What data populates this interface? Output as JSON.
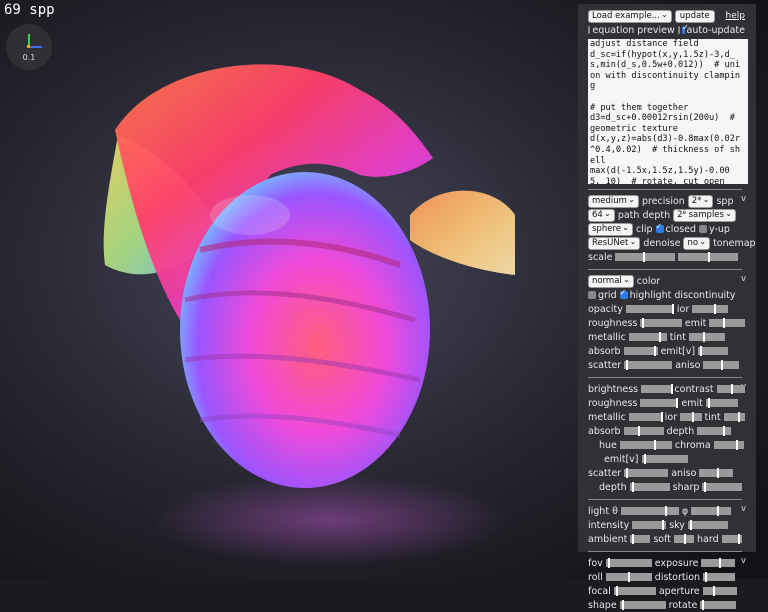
{
  "overlay": {
    "spp_text": "69 spp",
    "axes_scale": "0.1"
  },
  "panel": {
    "top": {
      "load_select": "Load example...",
      "update_label": "update",
      "help_label": "help",
      "equation_preview": "equation preview",
      "auto_update": "auto-update"
    },
    "code_lines": [
      "adjust distance field",
      "d_sc=if(hypot(x,y,1.5z)-3,d_",
      "s,min(d_s,0.5w+0.012))  # uni",
      "on with discontinuity clampin",
      "g",
      "",
      "# put them together",
      "d3=d_sc+0.00012rsin(200u)  #",
      "geometric texture",
      "d(x,y,z)=abs(d3)-0.8max(0.02r",
      "^0.4,0.02)  # thickness of sh",
      "ell",
      "max(d(-1.5x,1.5z,1.5y)-0.00",
      "5, 10)  # rotate, cut open"
    ],
    "render": {
      "precision_value": "medium",
      "precision_label": "precision",
      "spp_value": "2*",
      "spp_label": "spp",
      "depth_value": "64",
      "depth_label": "path depth",
      "samples_value": "2⁸ samples",
      "clip_value": "sphere",
      "clip_label": "clip",
      "closed_label": "closed",
      "yup_label": "y-up",
      "denoise_value": "ResUNet",
      "denoise_label": "denoise",
      "tonemap_value": "no",
      "tonemap_label": "tonemap",
      "scale_label": "scale",
      "chevron": "v"
    },
    "material": {
      "color_mode": "normal",
      "color_label": "color",
      "grid_label": "grid",
      "highlight_label": "highlight discontinuity",
      "opacity": "opacity",
      "ior": "ior",
      "roughness": "roughness",
      "emit": "emit",
      "metallic": "metallic",
      "tint": "tint",
      "absorb": "absorb",
      "emitv": "emit[v]",
      "scatter": "scatter",
      "aniso": "aniso",
      "chevron": "v"
    },
    "post": {
      "brightness": "brightness",
      "contrast": "contrast",
      "roughness": "roughness",
      "emit": "emit",
      "metallic": "metallic",
      "ior": "ior",
      "tint": "tint",
      "absorb": "absorb",
      "depth": "depth",
      "hue": "hue",
      "chroma": "chroma",
      "emitv": "emit[v]",
      "scatter": "scatter",
      "aniso": "aniso",
      "depth2": "depth",
      "sharp": "sharp",
      "chevron": "v"
    },
    "light": {
      "light": "light θ",
      "phi": "φ",
      "intensity": "intensity",
      "sky": "sky",
      "ambient": "ambient",
      "soft": "soft",
      "hard": "hard",
      "chevron": "v"
    },
    "camera": {
      "fov": "fov",
      "exposure": "exposure",
      "roll": "roll",
      "distortion": "distortion",
      "focal": "focal",
      "aperture": "aperture",
      "shape": "shape",
      "rotate": "rotate",
      "chevron": "v"
    }
  },
  "colors": {
    "panel": "#303036",
    "accent": "#2b7de9",
    "spp_text": "#ffffff"
  }
}
